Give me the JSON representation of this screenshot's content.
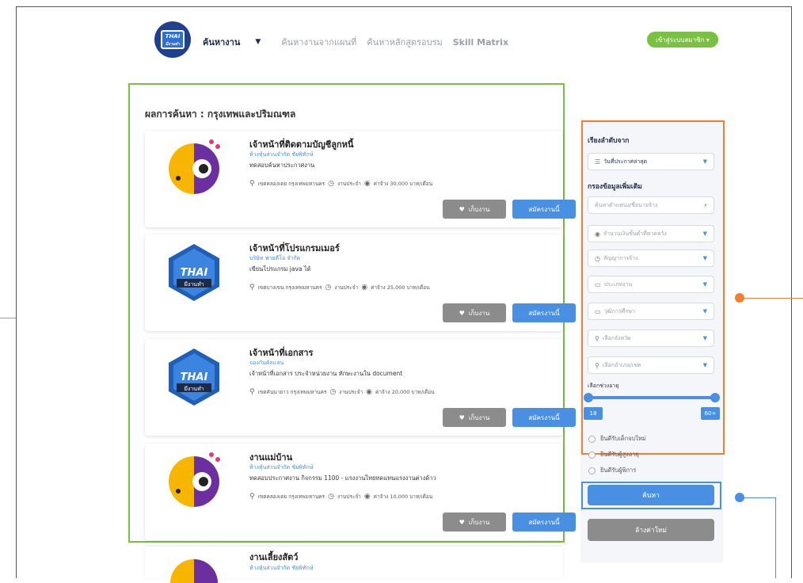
{
  "header": {
    "logo_text_top": "THAI",
    "logo_text_bottom": "มีงานทำ",
    "nav": [
      {
        "label": "ค้นหางาน",
        "active": true
      },
      {
        "label": "ค้นหางานจากแผนที่",
        "active": false
      },
      {
        "label": "ค้นหาหลักสูตรอบรม",
        "active": false
      },
      {
        "label": "Skill Matrix",
        "active": false
      }
    ],
    "member_button": "เข้าสู่ระบบสมาชิก ▾"
  },
  "results": {
    "title": "ผลการค้นหา : กรุงเทพและปริมณฑล",
    "save_label": "เก็บงาน",
    "apply_label": "สมัครงานนี้",
    "cards": [
      {
        "title": "เจ้าหน้าที่ติดตามบัญชีลูกหนี้",
        "company": "ห้างหุ้นส่วนจำกัด ชัยพิทักษ์",
        "desc": "ทดสอบค้นหาประกาศงาน",
        "location": "เขตคลองเตย กรุงเทพมหานคร",
        "type": "งานประจำ",
        "salary": "ค่าจ้าง 30,000 บาท/เดือน",
        "logo": "parrot"
      },
      {
        "title": "เจ้าหน้าที่โปรแกรมเมอร์",
        "company": "บริษัท ฟายดีโอ จำกัด",
        "desc": "เขียนโปรแกรม java ได้",
        "location": "เขตบางเขน กรุงเทพมหานคร",
        "type": "งานประจำ",
        "salary": "ค่าจ้าง 25,000 บาท/เดือน",
        "logo": "thai"
      },
      {
        "title": "เจ้าหน้าที่เอกสาร",
        "company": "จองกันคัลแลน",
        "desc": "เจ้าหน้าที่เอกสาร ประจำหน่วยงาน ทักษะงานใน document",
        "location": "เขตคันนายาว กรุงเทพมหานคร",
        "type": "งานประจำ",
        "salary": "ค่าจ้าง 20,000 บาท/เดือน",
        "logo": "thai"
      },
      {
        "title": "งานแม่บ้าน",
        "company": "ห้างหุ้นส่วนจำกัด ชัยพิทักษ์",
        "desc": "ทดสอบประกาศงาน กิจกรรม 1100 - แรงงานไทยทดแทนแรงงานต่างด้าว",
        "location": "เขตคลองเตย กรุงเทพมหานคร",
        "type": "งานประจำ",
        "salary": "ค่าจ้าง 10,000 บาท/เดือน",
        "logo": "parrot"
      }
    ],
    "peek": {
      "title": "งานเลี้ยงสัตว์",
      "company": "ห้างหุ้นส่วนจำกัด ชัยพิทักษ์"
    }
  },
  "sidebar": {
    "sort_heading": "เรียงลำดับจาก",
    "sort_value": "วันที่ประกาศล่าสุด",
    "filter_heading": "กรองข้อมูลเพิ่มเติม",
    "search_placeholder": "ค้นหาตำแหน่ง/ชื่อนายจ้าง",
    "selects": [
      "จำนวนเงินขั้นต่ำที่คาดหวัง",
      "สัญญาการจ้าง",
      "ประเภทงาน",
      "วุฒิการศึกษา",
      "เลือกจังหวัด",
      "เลือกอำเภอ/เขต"
    ],
    "age_label": "เลือกช่วงอายุ",
    "age_min": "18",
    "age_max": "60+",
    "checkboxes": [
      "ยินดีรับเด็กจบใหม่",
      "ยินดีรับผู้สูงอายุ",
      "ยินดีรับผู้พิการ"
    ],
    "search_button": "ค้นหา",
    "reset_button": "ล้างค่าใหม่"
  },
  "colors": {
    "green": "#7ac143",
    "orange": "#f08033",
    "blue": "#4a90e2"
  }
}
